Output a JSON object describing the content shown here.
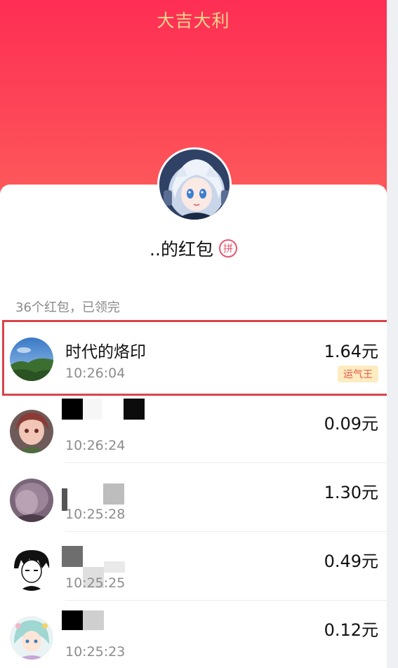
{
  "header": {
    "title": "大吉大利"
  },
  "owner": {
    "name": "..的红包",
    "badge": "拼"
  },
  "summary": "36个红包，已领完",
  "entries": [
    {
      "name": "时代的烙印",
      "time": "10:26:04",
      "amount": "1.64元",
      "tag": "运气王"
    },
    {
      "name": "",
      "time": "10:26:24",
      "amount": "0.09元"
    },
    {
      "name": "",
      "time": "10:25:28",
      "amount": "1.30元"
    },
    {
      "name": "",
      "time": "10:25:25",
      "amount": "0.49元"
    },
    {
      "name": "",
      "time": "10:25:23",
      "amount": "0.12元"
    }
  ],
  "colors": {
    "header_top": "#fe2e54",
    "header_bottom": "#fd5d5b",
    "title": "#f6d58e",
    "luck_tag_bg": "#fdecc0",
    "luck_tag_text": "#e8564f",
    "highlight": "#d9444a"
  },
  "icons": {
    "owner_avatar": "anime-character-avatar",
    "pin_badge": "pin-circle-icon"
  }
}
